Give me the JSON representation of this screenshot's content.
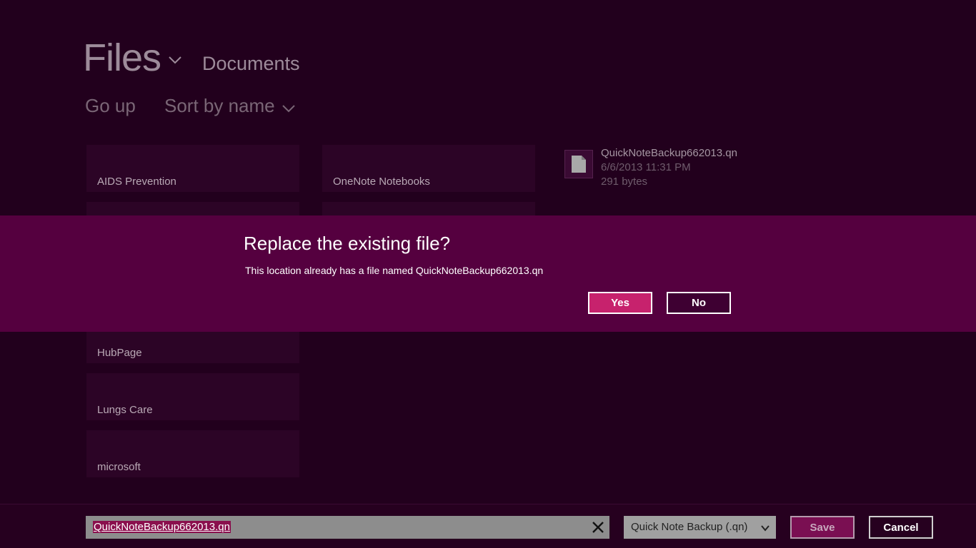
{
  "header": {
    "title": "Files",
    "location": "Documents"
  },
  "toolbar": {
    "go_up_label": "Go up",
    "sort_label": "Sort by name"
  },
  "folders": [
    {
      "label": "AIDS Prevention"
    },
    {
      "label": "OneNote Notebooks"
    },
    {
      "label": "HubPage"
    },
    {
      "label": "Lungs Care"
    },
    {
      "label": "microsoft"
    }
  ],
  "file": {
    "name": "QuickNoteBackup662013.qn",
    "date": "6/6/2013 11:31 PM",
    "size": "291 bytes",
    "icon": "document-icon"
  },
  "dialog": {
    "title": "Replace the existing file?",
    "message": "This location already has a file named QuickNoteBackup662013.qn",
    "yes_label": "Yes",
    "no_label": "No"
  },
  "bottom_bar": {
    "filename_value": "QuickNoteBackup662013.qn",
    "file_type": "Quick Note Backup (.qn)",
    "save_label": "Save",
    "cancel_label": "Cancel"
  },
  "colors": {
    "background": "#22001d",
    "dialog": "#55003f",
    "accent": "#c7226d"
  }
}
